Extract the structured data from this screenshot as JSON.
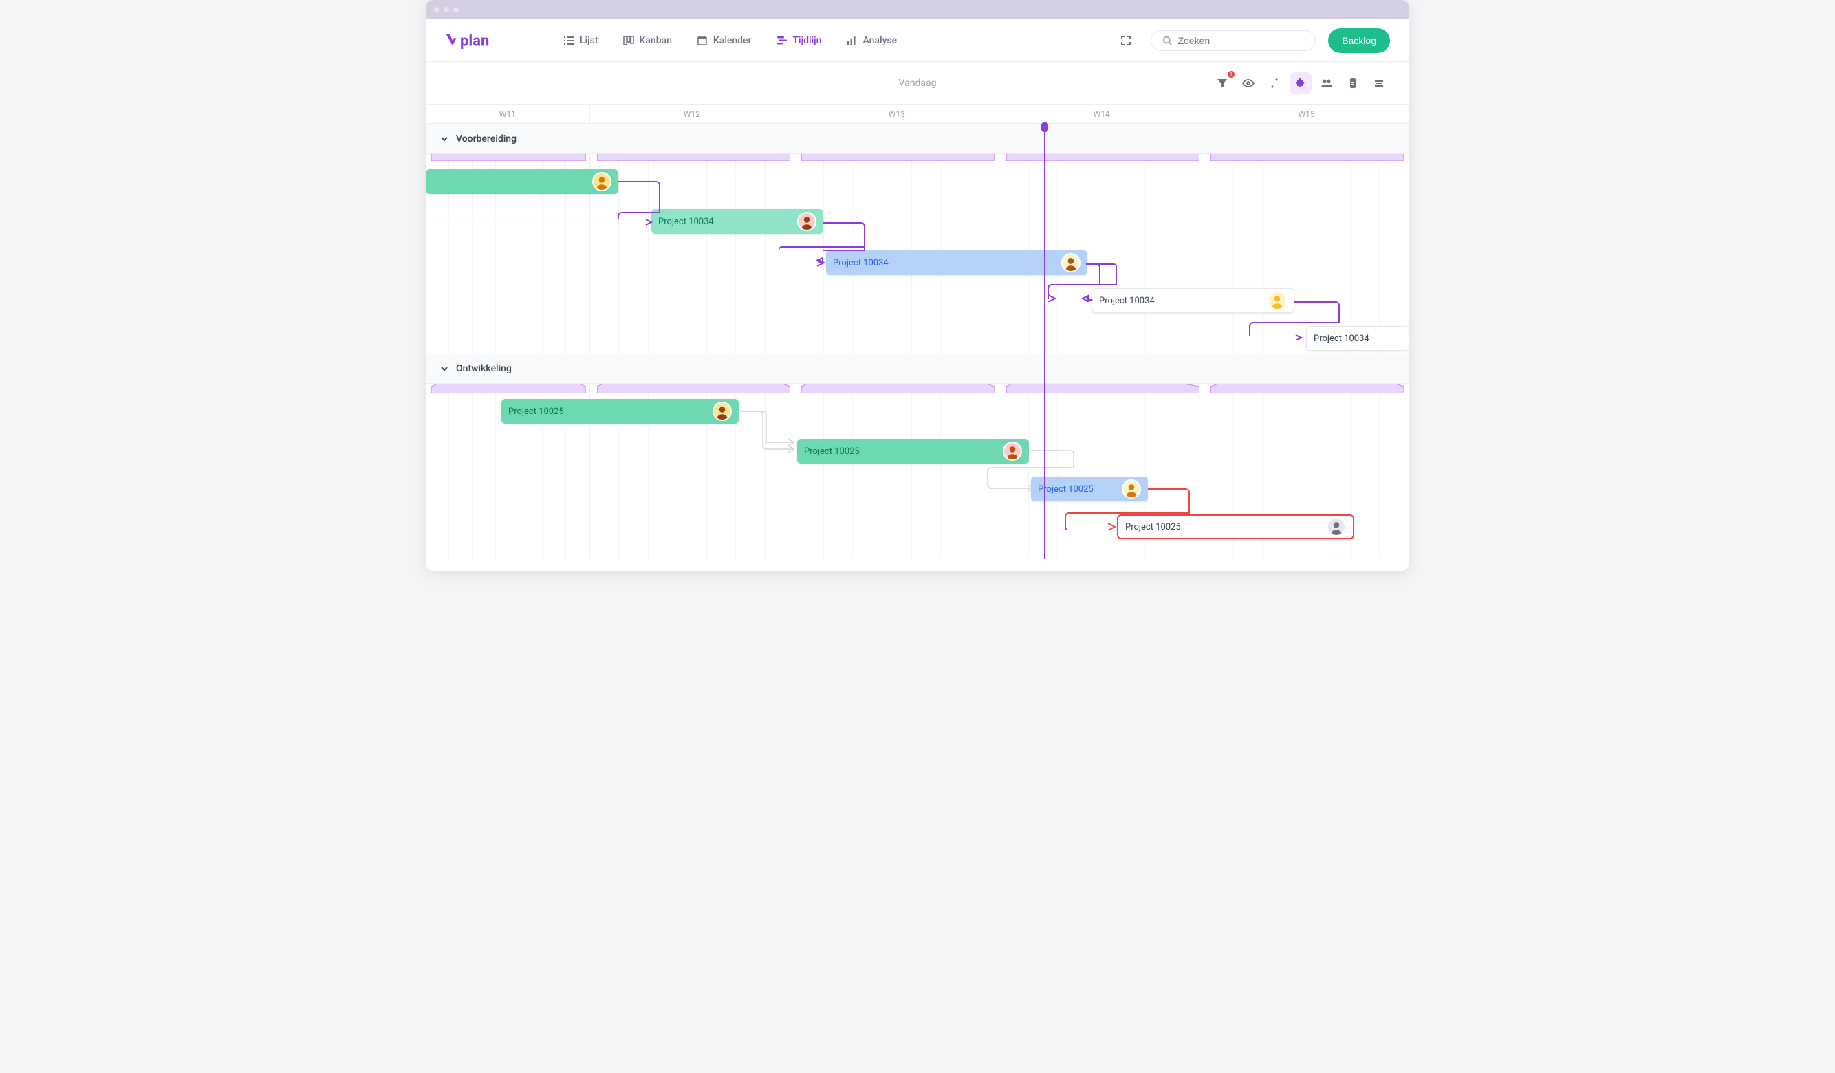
{
  "nav": {
    "items": [
      {
        "label": "Lijst",
        "icon": "list"
      },
      {
        "label": "Kanban",
        "icon": "kanban"
      },
      {
        "label": "Kalender",
        "icon": "calendar"
      },
      {
        "label": "Tijdlijn",
        "icon": "timeline",
        "active": true
      },
      {
        "label": "Analyse",
        "icon": "chart"
      }
    ]
  },
  "search": {
    "placeholder": "Zoeken"
  },
  "backlog_label": "Backlog",
  "today_label": "Vandaag",
  "filter_badge": "1",
  "weeks": [
    "W11",
    "W12",
    "W13",
    "W14",
    "W15"
  ],
  "groups": [
    {
      "title": "Voorbereiding",
      "tasks": [
        {
          "label": "",
          "color": "teal"
        },
        {
          "label": "Project 10034",
          "color": "green"
        },
        {
          "label": "Project 10034",
          "color": "blue"
        },
        {
          "label": "Project 10034",
          "color": "white"
        },
        {
          "label": "Project 10034",
          "color": "white"
        }
      ]
    },
    {
      "title": "Ontwikkeling",
      "tasks": [
        {
          "label": "Project 10025",
          "color": "teal"
        },
        {
          "label": "Project 10025",
          "color": "teal"
        },
        {
          "label": "Project 10025",
          "color": "blue"
        },
        {
          "label": "Project 10025",
          "color": "white-red"
        }
      ]
    }
  ],
  "colors": {
    "accent": "#8b3dd9",
    "success": "#1dbd8c",
    "error": "#ef4444"
  }
}
